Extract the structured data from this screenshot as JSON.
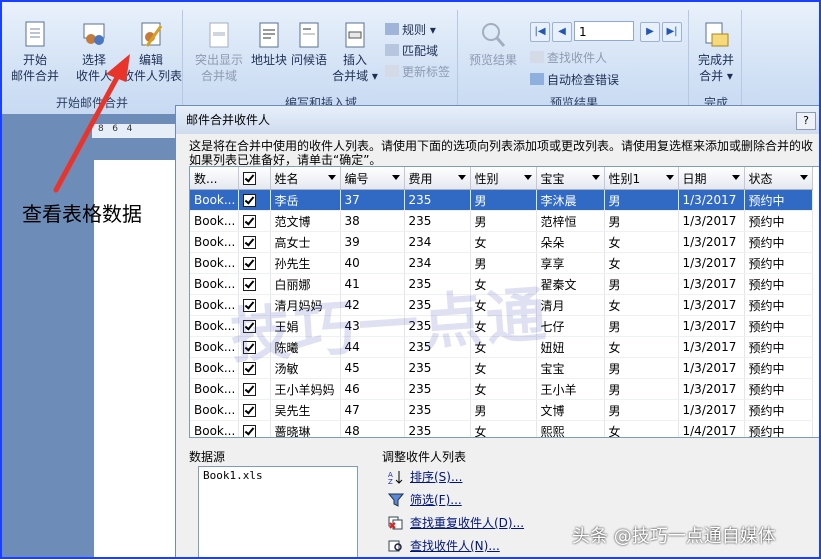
{
  "ribbon": {
    "groups": {
      "start_merge": "开始邮件合并",
      "write_insert": "编写和插入域",
      "preview": "预览结果",
      "finish": "完成"
    },
    "buttons": {
      "start_merge": [
        "开始",
        "邮件合并"
      ],
      "select_recipients": [
        "选择",
        "收件人"
      ],
      "edit_recipients": [
        "编辑",
        "收件人列表"
      ],
      "highlight_fields": [
        "突出显示",
        "合并域"
      ],
      "address_block": "地址块",
      "greeting_line": "问候语",
      "insert_merge_field": [
        "插入",
        "合并域"
      ],
      "rules": "规则",
      "match_fields": "匹配域",
      "update_labels": "更新标签",
      "preview_results": "预览结果",
      "find_recipient": "查找收件人",
      "auto_check_errors": "自动检查错误",
      "finish_merge": [
        "完成并",
        "合并"
      ]
    },
    "record_number": "1"
  },
  "ruler_marks": "8   6   4",
  "annotation": "查看表格数据",
  "dialog": {
    "title": "邮件合并收件人",
    "help": "?",
    "description_line1": "这是将在合并中使用的收件人列表。请使用下面的选项向列表添加项或更改列表。请使用复选框来添加或删除合并的收",
    "description_line2": "如果列表已准备好，请单击“确定”。",
    "columns": [
      "数...",
      "",
      "姓名",
      "编号",
      "费用",
      "性别",
      "宝宝",
      "性别1",
      "日期",
      "状态"
    ],
    "rows": [
      {
        "src": "Book...",
        "name": "李岳",
        "id": "37",
        "fee": "235",
        "sex": "男",
        "baby": "李沐晨",
        "sex1": "男",
        "date": "1/3/2017",
        "status": "预约中"
      },
      {
        "src": "Book...",
        "name": "范文博",
        "id": "38",
        "fee": "235",
        "sex": "男",
        "baby": "范梓恒",
        "sex1": "男",
        "date": "1/3/2017",
        "status": "预约中"
      },
      {
        "src": "Book...",
        "name": "高女士",
        "id": "39",
        "fee": "234",
        "sex": "女",
        "baby": "朵朵",
        "sex1": "女",
        "date": "1/3/2017",
        "status": "预约中"
      },
      {
        "src": "Book...",
        "name": "孙先生",
        "id": "40",
        "fee": "234",
        "sex": "男",
        "baby": "享享",
        "sex1": "女",
        "date": "1/3/2017",
        "status": "预约中"
      },
      {
        "src": "Book...",
        "name": "白丽娜",
        "id": "41",
        "fee": "235",
        "sex": "女",
        "baby": "翟秦文",
        "sex1": "男",
        "date": "1/3/2017",
        "status": "预约中"
      },
      {
        "src": "Book...",
        "name": "清月妈妈",
        "id": "42",
        "fee": "235",
        "sex": "女",
        "baby": "清月",
        "sex1": "女",
        "date": "1/3/2017",
        "status": "预约中"
      },
      {
        "src": "Book...",
        "name": "王娟",
        "id": "43",
        "fee": "235",
        "sex": "女",
        "baby": "七仔",
        "sex1": "男",
        "date": "1/3/2017",
        "status": "预约中"
      },
      {
        "src": "Book...",
        "name": "陈曦",
        "id": "44",
        "fee": "235",
        "sex": "女",
        "baby": "妞妞",
        "sex1": "女",
        "date": "1/3/2017",
        "status": "预约中"
      },
      {
        "src": "Book...",
        "name": "汤敏",
        "id": "45",
        "fee": "235",
        "sex": "女",
        "baby": "宝宝",
        "sex1": "男",
        "date": "1/3/2017",
        "status": "预约中"
      },
      {
        "src": "Book...",
        "name": "王小羊妈妈",
        "id": "46",
        "fee": "235",
        "sex": "女",
        "baby": "王小羊",
        "sex1": "男",
        "date": "1/3/2017",
        "status": "预约中"
      },
      {
        "src": "Book...",
        "name": "吴先生",
        "id": "47",
        "fee": "235",
        "sex": "男",
        "baby": "文博",
        "sex1": "男",
        "date": "1/3/2017",
        "status": "预约中"
      },
      {
        "src": "Book...",
        "name": "蔷晓琳",
        "id": "48",
        "fee": "235",
        "sex": "女",
        "baby": "熙熙",
        "sex1": "女",
        "date": "1/4/2017",
        "status": "预约中"
      }
    ],
    "watermark": "技巧一点通",
    "data_source_label": "数据源",
    "data_source_file": "Book1.xls",
    "adjust_label": "调整收件人列表",
    "adjust_links": [
      "排序(S)...",
      "筛选(F)...",
      "查找重复收件人(D)...",
      "查找收件人(N)..."
    ]
  },
  "footer_watermark": "头条 @技巧一点通自媒体"
}
